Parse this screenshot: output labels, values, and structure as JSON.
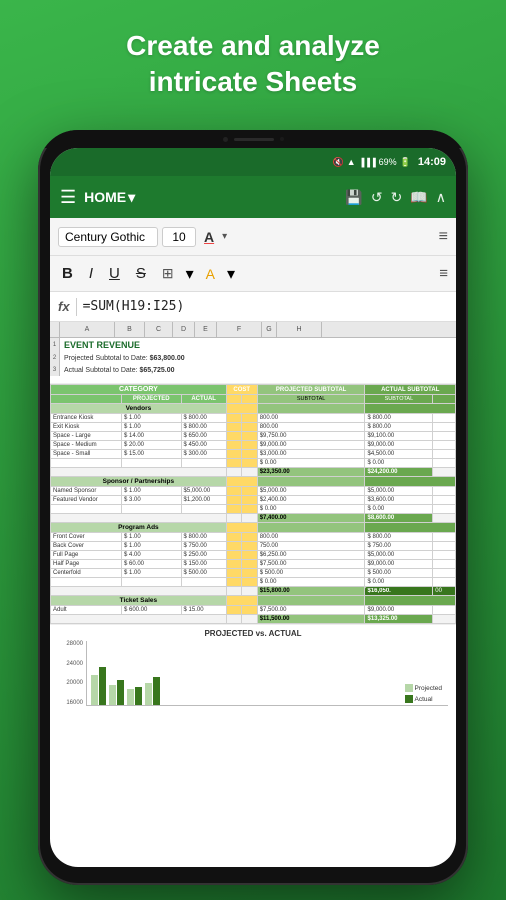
{
  "header": {
    "line1": "Create and analyze",
    "line2": "intricate Sheets"
  },
  "status_bar": {
    "battery": "69%",
    "time": "14:09"
  },
  "toolbar": {
    "home_label": "HOME",
    "dropdown_arrow": "▾"
  },
  "format_bar": {
    "font_name": "Century Gothic",
    "font_size": "10",
    "underline_label": "a"
  },
  "formula_bar": {
    "fx_label": "fx",
    "formula": "=SUM(H19:I25)"
  },
  "spreadsheet": {
    "title": "EVENT REVENUE",
    "projected_subtotal_label": "Projected Subtotal to Date:",
    "projected_subtotal_value": "$63,800.00",
    "actual_subtotal_label": "Actual Subtotal to Date:",
    "actual_subtotal_value": "$65,725.00",
    "col_headers": [
      "A",
      "B",
      "C",
      "D",
      "E",
      "F",
      "G",
      "H"
    ],
    "headers": {
      "category": "CATEGORY",
      "cost": "COST",
      "projected_subtotal": "PROJECTED SUBTOTAL",
      "actual_subtotal": "ACTUAL SUBTOTAL",
      "projected": "PROJECTED",
      "actual": "ACTUAL",
      "subtotal": "SUBTOTAL"
    },
    "sections": [
      {
        "name": "Vendors",
        "rows": [
          {
            "category": "Entrance Kiosk",
            "projected": "$ 1.00",
            "actual": "$ 800.00",
            "subtotal": "",
            "projected_sub": "800.00",
            "actual_sub": "$ 800.00"
          },
          {
            "category": "Exit Kiosk",
            "projected": "$ 1.00",
            "actual": "$ 800.00",
            "subtotal": "",
            "projected_sub": "800.00",
            "actual_sub": "$ 800.00"
          },
          {
            "category": "Space - Large",
            "projected": "$ 14.00",
            "actual": "$ 650.00",
            "subtotal": "",
            "projected_sub": "$9,750.00",
            "actual_sub": "$9,100.00"
          },
          {
            "category": "Space - Medium",
            "projected": "$ 20.00",
            "actual": "$ 450.00",
            "subtotal": "",
            "projected_sub": "$9,000.00",
            "actual_sub": "$9,000.00"
          },
          {
            "category": "Space - Small",
            "projected": "$ 15.00",
            "actual": "$ 300.00",
            "subtotal": "",
            "projected_sub": "$3,000.00",
            "actual_sub": "$4,500.00"
          },
          {
            "category": "",
            "projected": "",
            "actual": "",
            "subtotal": "",
            "projected_sub": "$ 0.00",
            "actual_sub": "$ 0.00"
          },
          {
            "category": "",
            "projected": "",
            "actual": "",
            "subtotal": "",
            "projected_sub": "$ 0.00",
            "actual_sub": "$ 0.00"
          }
        ],
        "subtotal_row": {
          "label": "",
          "projected": "$23,350.00",
          "actual": "$24,200.00"
        }
      },
      {
        "name": "Sponsor / Partnerships",
        "rows": [
          {
            "category": "Named Sponsor",
            "projected": "$ 1.00",
            "actual": "$5,000.00",
            "subtotal": "",
            "projected_sub": "$5,000.00",
            "actual_sub": "$5,000.00"
          },
          {
            "category": "Featured Vendor",
            "projected": "$ 3.00",
            "actual": "$1,200.00",
            "subtotal": "",
            "projected_sub": "$2,400.00",
            "actual_sub": "$3,600.00"
          },
          {
            "category": "",
            "projected": "",
            "actual": "",
            "subtotal": "",
            "projected_sub": "$ 0.00",
            "actual_sub": "$ 0.00"
          },
          {
            "category": "",
            "projected": "",
            "actual": "",
            "subtotal": "",
            "projected_sub": "$ 0.00",
            "actual_sub": "$ 0.00"
          }
        ],
        "subtotal_row": {
          "label": "",
          "projected": "$7,400.00",
          "actual": "$8,600.00"
        }
      },
      {
        "name": "Program Ads",
        "rows": [
          {
            "category": "Front Cover",
            "projected": "$ 1.00",
            "actual": "$ 800.00",
            "subtotal": "",
            "projected_sub": "800.00",
            "actual_sub": "$ 800.00"
          },
          {
            "category": "Back Cover",
            "projected": "$ 1.00",
            "actual": "$ 750.00",
            "subtotal": "",
            "projected_sub": "750.00",
            "actual_sub": "$ 750.00"
          },
          {
            "category": "Full Page",
            "projected": "$ 4.00",
            "actual": "$ 250.00",
            "subtotal": "",
            "projected_sub": "$6,250.00",
            "actual_sub": "$5,000.00"
          },
          {
            "category": "Half Page",
            "projected": "$ 60.00",
            "actual": "$ 150.00",
            "subtotal": "",
            "projected_sub": "$7,500.00",
            "actual_sub": "$9,000.00"
          },
          {
            "category": "Centerfold",
            "projected": "$ 1.00",
            "actual": "$ 500.00",
            "subtotal": "",
            "projected_sub": "$ 500.00",
            "actual_sub": "$ 500.00"
          },
          {
            "category": "",
            "projected": "",
            "actual": "",
            "subtotal": "",
            "projected_sub": "$ 0.00",
            "actual_sub": "$ 0.00"
          },
          {
            "category": "",
            "projected": "",
            "actual": "",
            "subtotal": "",
            "projected_sub": "$ 0.00",
            "actual_sub": "$ 0.00"
          }
        ],
        "subtotal_row": {
          "label": "",
          "projected": "$15,800.00",
          "actual": "$16,050.00"
        }
      },
      {
        "name": "Ticket Sales",
        "rows": [
          {
            "category": "Adult",
            "projected": "$ 600.00",
            "actual": "$ 15.00",
            "subtotal": "",
            "projected_sub": "$7,500.00",
            "actual_sub": "$9,000.00"
          }
        ],
        "subtotal_row": {
          "label": "",
          "projected": "$11,500.00",
          "actual": "$13,325.00"
        }
      }
    ]
  },
  "chart": {
    "title": "PROJECTED vs. ACTUAL",
    "y_labels": [
      "28000",
      "24000",
      "20000",
      "16000"
    ],
    "legend": [
      {
        "label": "Projected",
        "color": "#b6d7a8"
      },
      {
        "label": "Actual",
        "color": "#38761d"
      }
    ],
    "bars": [
      {
        "projected_h": 30,
        "actual_h": 38
      },
      {
        "projected_h": 20,
        "actual_h": 25
      },
      {
        "projected_h": 15,
        "actual_h": 18
      },
      {
        "projected_h": 22,
        "actual_h": 28
      }
    ]
  }
}
